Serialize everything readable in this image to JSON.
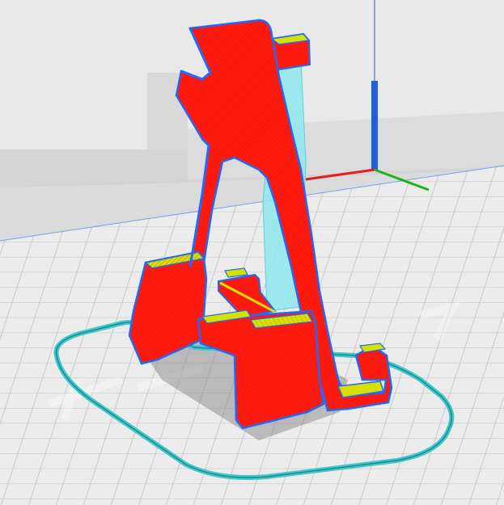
{
  "viewport": {
    "background_color": "#e9e9e9",
    "build_plate_color": "#ececec",
    "grid_color": "#c8c8c8",
    "back_wall_color": "#d9d9d9",
    "side_wall_color": "#c4c4c4",
    "shadow_color": "#7f7f7f"
  },
  "model": {
    "name": "phone-stand",
    "body_color": "#ff1a0f",
    "outer_wall_color": "#1e6bff",
    "top_surface_color": "#d8e000",
    "support_color": "#8fe8ec",
    "brim_color": "#41c7cc"
  },
  "axes": {
    "x_color": "#e02020",
    "y_color": "#1bb51b",
    "z_color": "#1f5fd8"
  },
  "icons": {
    "axis_gizmo": "xyz-axis-gizmo-icon"
  }
}
